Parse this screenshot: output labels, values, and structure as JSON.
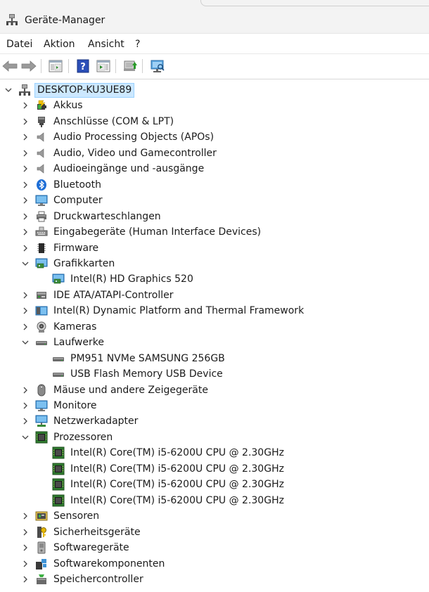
{
  "window": {
    "title": "Geräte-Manager"
  },
  "menu": {
    "items": [
      "Datei",
      "Aktion",
      "Ansicht",
      "?"
    ]
  },
  "tree": {
    "root": "DESKTOP-KU3UE89",
    "rows": [
      {
        "label": "Akkus",
        "level": 1,
        "state": "collapsed",
        "icon": "battery-icon"
      },
      {
        "label": "Anschlüsse (COM & LPT)",
        "level": 1,
        "state": "collapsed",
        "icon": "port-icon"
      },
      {
        "label": "Audio Processing Objects (APOs)",
        "level": 1,
        "state": "collapsed",
        "icon": "speaker-icon"
      },
      {
        "label": "Audio, Video und Gamecontroller",
        "level": 1,
        "state": "collapsed",
        "icon": "speaker-icon"
      },
      {
        "label": "Audioeingänge und -ausgänge",
        "level": 1,
        "state": "collapsed",
        "icon": "speaker-icon"
      },
      {
        "label": "Bluetooth",
        "level": 1,
        "state": "collapsed",
        "icon": "bluetooth-icon"
      },
      {
        "label": "Computer",
        "level": 1,
        "state": "collapsed",
        "icon": "monitor-icon"
      },
      {
        "label": "Druckwarteschlangen",
        "level": 1,
        "state": "collapsed",
        "icon": "printer-icon"
      },
      {
        "label": "Eingabegeräte (Human Interface Devices)",
        "level": 1,
        "state": "collapsed",
        "icon": "hid-icon"
      },
      {
        "label": "Firmware",
        "level": 1,
        "state": "collapsed",
        "icon": "chip-icon"
      },
      {
        "label": "Grafikkarten",
        "level": 1,
        "state": "expanded",
        "icon": "display-adapter-icon"
      },
      {
        "label": "Intel(R) HD Graphics 520",
        "level": 2,
        "state": "leaf",
        "icon": "display-adapter-icon"
      },
      {
        "label": "IDE ATA/ATAPI-Controller",
        "level": 1,
        "state": "collapsed",
        "icon": "ide-controller-icon"
      },
      {
        "label": "Intel(R) Dynamic Platform and Thermal Framework",
        "level": 1,
        "state": "collapsed",
        "icon": "system-folder-icon"
      },
      {
        "label": "Kameras",
        "level": 1,
        "state": "collapsed",
        "icon": "camera-icon"
      },
      {
        "label": "Laufwerke",
        "level": 1,
        "state": "expanded",
        "icon": "drive-icon"
      },
      {
        "label": "PM951 NVMe SAMSUNG 256GB",
        "level": 2,
        "state": "leaf",
        "icon": "drive-icon"
      },
      {
        "label": "USB Flash Memory USB Device",
        "level": 2,
        "state": "leaf",
        "icon": "drive-icon"
      },
      {
        "label": "Mäuse und andere Zeigegeräte",
        "level": 1,
        "state": "collapsed",
        "icon": "mouse-icon"
      },
      {
        "label": "Monitore",
        "level": 1,
        "state": "collapsed",
        "icon": "monitor-icon"
      },
      {
        "label": "Netzwerkadapter",
        "level": 1,
        "state": "collapsed",
        "icon": "network-icon"
      },
      {
        "label": "Prozessoren",
        "level": 1,
        "state": "expanded",
        "icon": "processor-icon"
      },
      {
        "label": "Intel(R) Core(TM) i5-6200U CPU @ 2.30GHz",
        "level": 2,
        "state": "leaf",
        "icon": "processor-icon"
      },
      {
        "label": "Intel(R) Core(TM) i5-6200U CPU @ 2.30GHz",
        "level": 2,
        "state": "leaf",
        "icon": "processor-icon"
      },
      {
        "label": "Intel(R) Core(TM) i5-6200U CPU @ 2.30GHz",
        "level": 2,
        "state": "leaf",
        "icon": "processor-icon"
      },
      {
        "label": "Intel(R) Core(TM) i5-6200U CPU @ 2.30GHz",
        "level": 2,
        "state": "leaf",
        "icon": "processor-icon"
      },
      {
        "label": "Sensoren",
        "level": 1,
        "state": "collapsed",
        "icon": "sensor-icon"
      },
      {
        "label": "Sicherheitsgeräte",
        "level": 1,
        "state": "collapsed",
        "icon": "security-device-icon"
      },
      {
        "label": "Softwaregeräte",
        "level": 1,
        "state": "collapsed",
        "icon": "software-device-icon"
      },
      {
        "label": "Softwarekomponenten",
        "level": 1,
        "state": "collapsed",
        "icon": "software-component-icon"
      },
      {
        "label": "Speichercontroller",
        "level": 1,
        "state": "collapsed",
        "icon": "storage-controller-icon"
      }
    ]
  },
  "colors": {
    "selection_bg": "#cce8ff",
    "selection_border": "#99d1ff",
    "text": "#1b1b1b"
  }
}
